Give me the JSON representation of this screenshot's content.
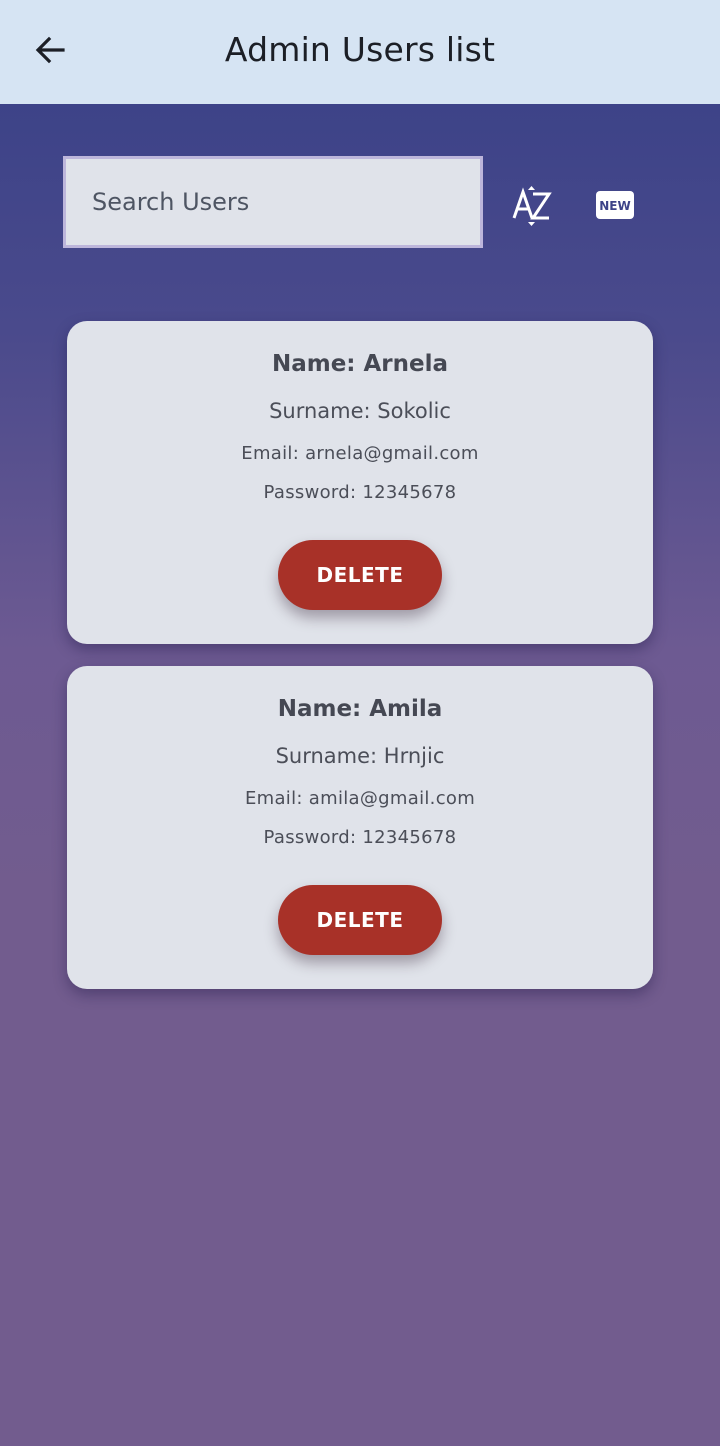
{
  "app_bar": {
    "title": "Admin Users list",
    "back_icon": "arrow-left-icon"
  },
  "toolbar": {
    "search_placeholder": "Search Users",
    "search_value": "",
    "sort_icon": "sort-az-icon",
    "new_icon": "new-badge-icon",
    "new_icon_text": "NEW"
  },
  "users": [
    {
      "name": "Name: Arnela",
      "surname": "Surname: Sokolic",
      "email": "Email: arnela@gmail.com",
      "password": "Password: 12345678",
      "delete_label": "DELETE"
    },
    {
      "name": "Name: Amila",
      "surname": "Surname: Hrnjic",
      "email": "Email: amila@gmail.com",
      "password": "Password: 12345678",
      "delete_label": "DELETE"
    }
  ],
  "colors": {
    "app_bar_bg": "#d6e4f3",
    "card_bg": "#e0e3ea",
    "delete_button": "#a83128",
    "background_top": "#313e86",
    "background_bottom": "#725c8e"
  }
}
